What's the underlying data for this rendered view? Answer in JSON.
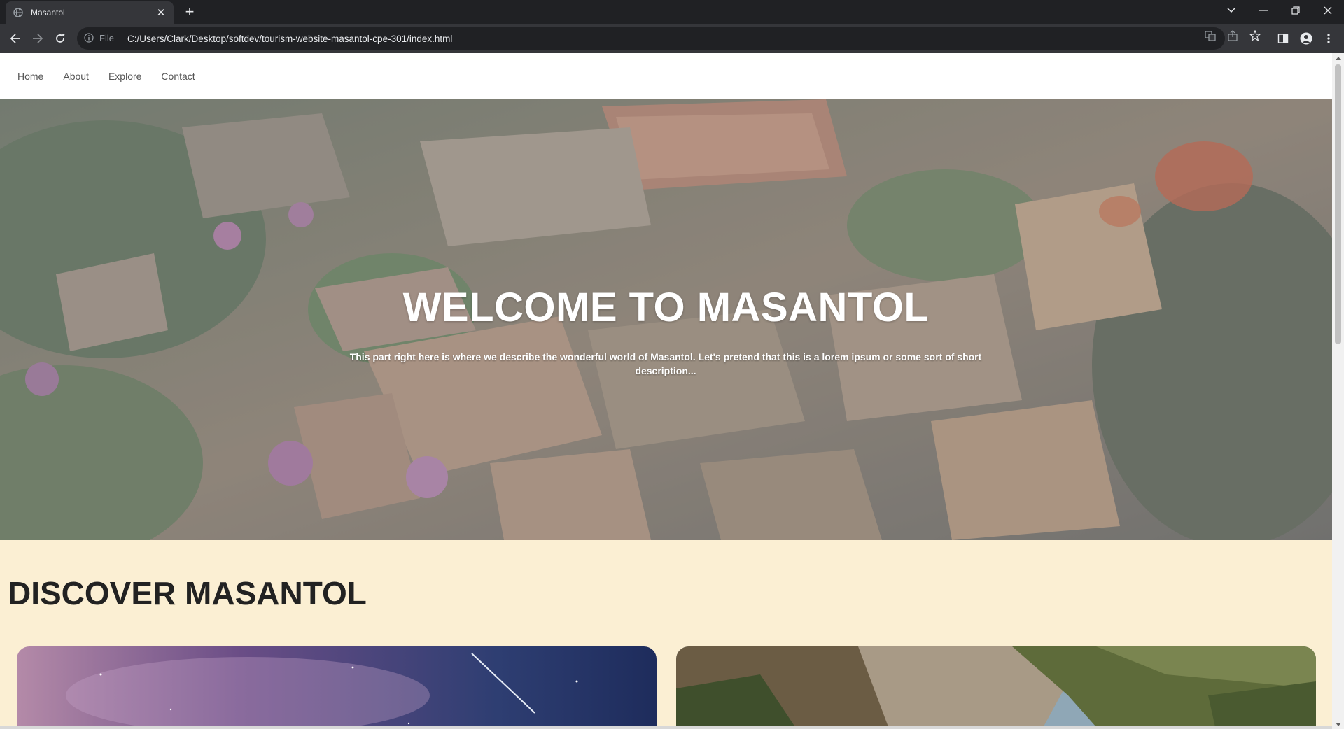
{
  "browser": {
    "tab_title": "Masantol",
    "scheme": "File",
    "url": "C:/Users/Clark/Desktop/softdev/tourism-website-masantol-cpe-301/index.html",
    "icons": [
      "globe-icon",
      "close-icon",
      "plus-icon",
      "chevron-down-icon",
      "minimize-icon",
      "restore-icon",
      "close-window-icon",
      "back-arrow-icon",
      "forward-arrow-icon",
      "reload-icon",
      "info-icon",
      "translate-icon",
      "share-icon",
      "star-icon",
      "side-panel-icon",
      "profile-icon",
      "kebab-menu-icon"
    ]
  },
  "nav": {
    "items": [
      {
        "label": "Home"
      },
      {
        "label": "About"
      },
      {
        "label": "Explore"
      },
      {
        "label": "Contact"
      }
    ]
  },
  "hero": {
    "title": "WELCOME TO MASANTOL",
    "subtitle": "This part right here is where we describe the wonderful world of Masantol. Let's pretend that this is a lorem ipsum or some sort of short description..."
  },
  "discover": {
    "title": "DISCOVER MASANTOL"
  },
  "colors": {
    "page_bg": "#fbefd3",
    "chrome_dark": "#202124",
    "chrome_toolbar": "#35363a"
  }
}
